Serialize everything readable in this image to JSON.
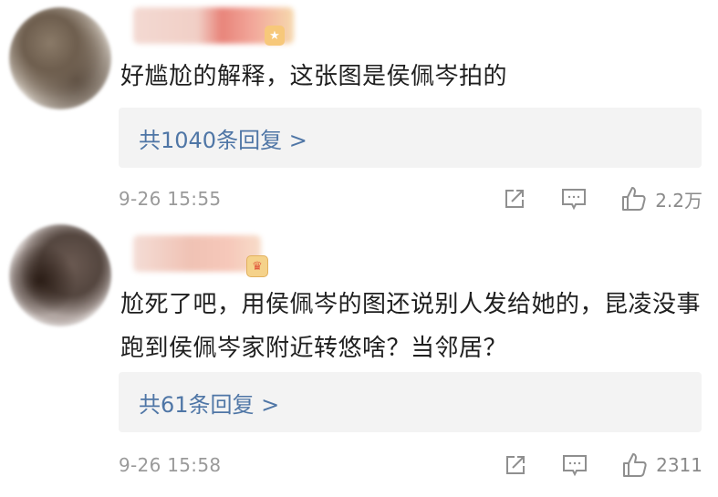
{
  "comments": [
    {
      "text": "好尴尬的解释，这张图是侯佩岑拍的",
      "replies_label": "共1040条回复 >",
      "timestamp": "9-26 15:55",
      "likes": "2.2万"
    },
    {
      "text": "尬死了吧，用侯佩岑的图还说别人发给她的，昆凌没事跑到侯佩岑家附近转悠啥？当邻居？",
      "replies_label": "共61条回复 >",
      "timestamp": "9-26 15:58",
      "likes": "2311"
    }
  ],
  "icons": {
    "share": "share-icon",
    "comment": "comment-icon",
    "like": "thumbs-up-icon"
  },
  "colors": {
    "reply_link": "#4f76a6",
    "reply_bg": "#f3f3f3",
    "meta_text": "#9a9a9a"
  }
}
